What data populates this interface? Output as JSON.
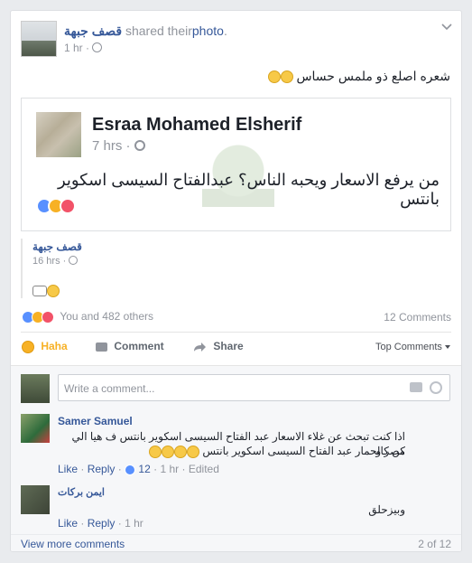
{
  "post": {
    "page_name": "قصف جبهة",
    "shared_text": "shared their",
    "photo_link": "photo",
    "time": "1 hr",
    "caption": "شعره اصلع ذو ملمس حساس",
    "shared_post": {
      "author": "Esraa Mohamed Elsherif",
      "time": "7 hrs",
      "text": "من يرفع الاسعار ويحبه الناس؟ عبدالفتاح السيسى اسكوير بانتس"
    },
    "sub_share": {
      "name": "قصف جبهة",
      "time": "16 hrs"
    },
    "reactions_summary": "You and 482 others",
    "comments_count": "12 Comments"
  },
  "actions": {
    "haha": "Haha",
    "comment": "Comment",
    "share": "Share",
    "top_comments": "Top Comments"
  },
  "comment_box": {
    "placeholder": "Write a comment..."
  },
  "comments": [
    {
      "name": "Samer Samuel",
      "line1": "اذا كنت تبحث عن غلاء الاسعار عبد الفتاح السيسى اسكوير بانتس ف هيا الي مصر و",
      "line2": "كن كالحمار عبد الفتاح السيسى اسكوير بانتس",
      "like": "Like",
      "reply": "Reply",
      "likes": "12",
      "time": "1 hr",
      "edited": "Edited"
    },
    {
      "name": "ايمن بركات",
      "text": "وبيزحلق",
      "like": "Like",
      "reply": "Reply",
      "time": "1 hr"
    }
  ],
  "footer": {
    "view_more": "View more comments",
    "pager": "2 of 12"
  },
  "colors": {
    "link": "#365899",
    "like_blue": "#5890ff",
    "haha_yellow": "#f7b125",
    "love_red": "#f25268"
  }
}
